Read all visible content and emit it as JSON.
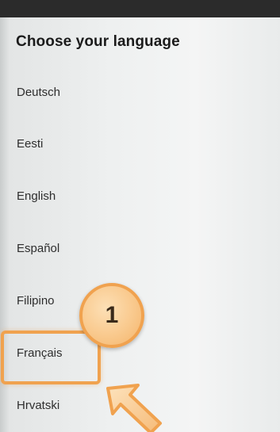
{
  "title": "Choose your language",
  "languages": [
    {
      "label": "Deutsch"
    },
    {
      "label": "Eesti"
    },
    {
      "label": "English"
    },
    {
      "label": "Español"
    },
    {
      "label": "Filipino"
    },
    {
      "label": "Français"
    },
    {
      "label": "Hrvatski"
    }
  ],
  "annotation": {
    "step_number": "1",
    "highlighted_item": "Français",
    "accent_color": "#f0a24f"
  }
}
